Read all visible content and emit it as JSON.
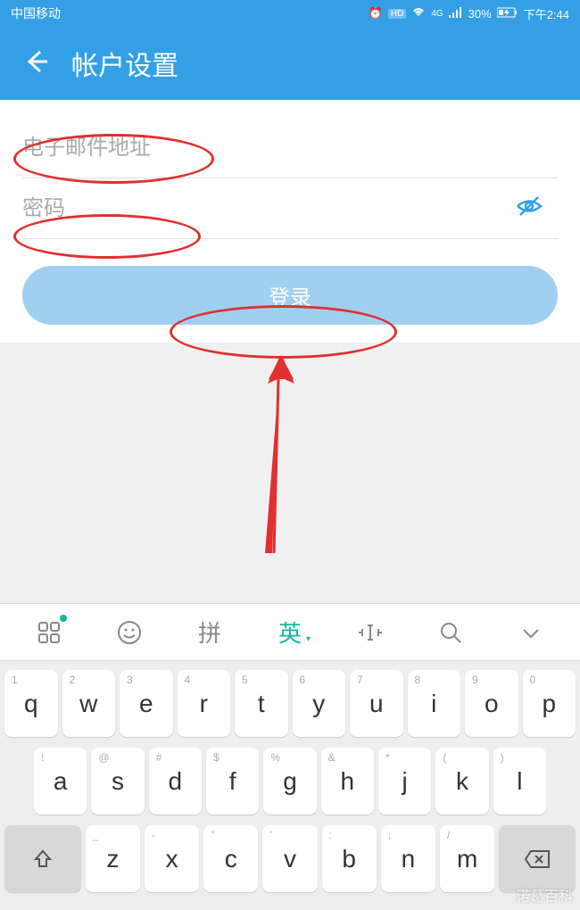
{
  "statusBar": {
    "carrier": "中国移动",
    "battery": "30%",
    "time": "下午2:44",
    "hd": "HD",
    "network": "4G"
  },
  "header": {
    "title": "帐户设置"
  },
  "form": {
    "emailPlaceholder": "电子邮件地址",
    "passwordPlaceholder": "密码",
    "loginLabel": "登录"
  },
  "keyboard": {
    "toolbar": {
      "pinyin": "拼",
      "english": "英"
    },
    "row1": [
      {
        "main": "q",
        "sub": "1"
      },
      {
        "main": "w",
        "sub": "2"
      },
      {
        "main": "e",
        "sub": "3"
      },
      {
        "main": "r",
        "sub": "4"
      },
      {
        "main": "t",
        "sub": "5"
      },
      {
        "main": "y",
        "sub": "6"
      },
      {
        "main": "u",
        "sub": "7"
      },
      {
        "main": "i",
        "sub": "8"
      },
      {
        "main": "o",
        "sub": "9"
      },
      {
        "main": "p",
        "sub": "0"
      }
    ],
    "row2": [
      {
        "main": "a",
        "sub": "!"
      },
      {
        "main": "s",
        "sub": "@"
      },
      {
        "main": "d",
        "sub": "#"
      },
      {
        "main": "f",
        "sub": "$"
      },
      {
        "main": "g",
        "sub": "%"
      },
      {
        "main": "h",
        "sub": "&"
      },
      {
        "main": "j",
        "sub": "*"
      },
      {
        "main": "k",
        "sub": "("
      },
      {
        "main": "l",
        "sub": ")"
      }
    ],
    "row3": [
      {
        "main": "z",
        "sub": "_"
      },
      {
        "main": "x",
        "sub": "-"
      },
      {
        "main": "c",
        "sub": "\""
      },
      {
        "main": "v",
        "sub": "'"
      },
      {
        "main": "b",
        "sub": ":"
      },
      {
        "main": "n",
        "sub": ";"
      },
      {
        "main": "m",
        "sub": "/"
      }
    ]
  },
  "watermark": "诺葛百科"
}
